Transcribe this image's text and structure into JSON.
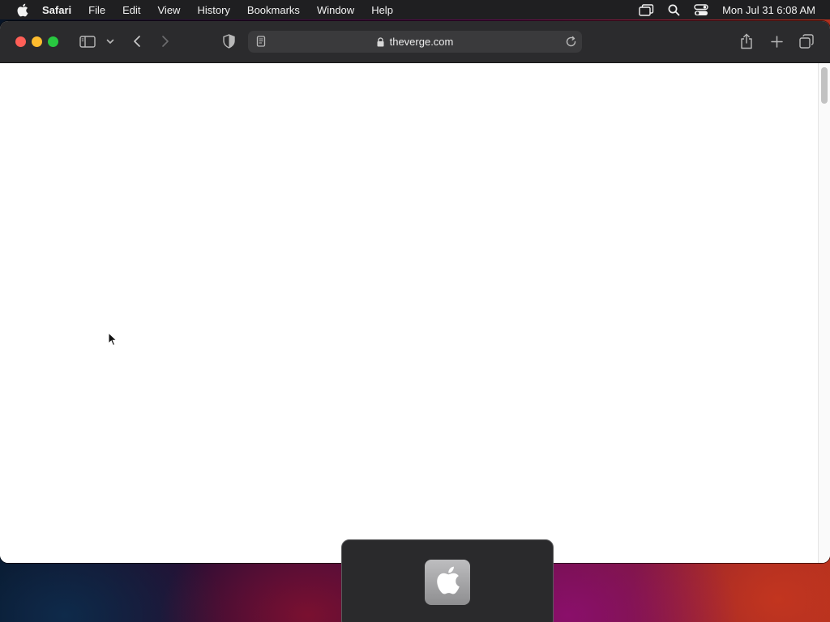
{
  "menubar": {
    "apple_icon": "apple-logo-icon",
    "app_name": "Safari",
    "menus": [
      "File",
      "Edit",
      "View",
      "History",
      "Bookmarks",
      "Window",
      "Help"
    ],
    "status_icons": [
      "stage-manager-icon",
      "spotlight-search-icon",
      "control-center-icon"
    ],
    "clock": "Mon Jul 31  6:08 AM"
  },
  "toolbar": {
    "icons": [
      "sidebar-toggle-icon",
      "chevron-down-icon",
      "back-arrow-icon",
      "forward-arrow-icon",
      "privacy-shield-icon",
      "share-icon",
      "new-tab-icon",
      "tab-overview-icon"
    ]
  },
  "address_bar": {
    "url": "theverge.com",
    "icons": [
      "reader-icon",
      "lock-icon",
      "reload-icon"
    ]
  },
  "colors": {
    "close": "#ff5f57",
    "minimize": "#febc2e",
    "maximize": "#28c840",
    "toolbar_bg": "#2b2b2d",
    "address_bg": "#3a3a3c"
  },
  "app_switcher": {
    "apps": [
      "apple-logo-icon"
    ]
  }
}
